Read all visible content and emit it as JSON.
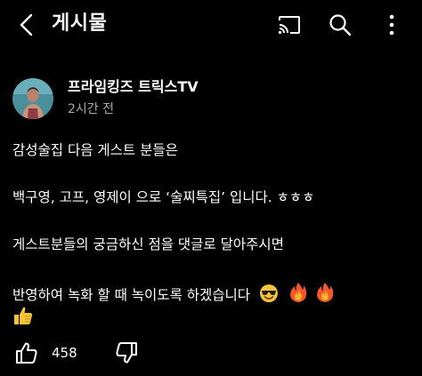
{
  "header": {
    "title": "게시물",
    "icons": [
      "back-arrow-icon",
      "cast-icon",
      "search-icon",
      "more-vertical-icon"
    ]
  },
  "post": {
    "channel_name": "프라임킹즈 트릭스TV",
    "time_ago": "2시간 전",
    "lines": [
      "감성술집 다음 게스트 분들은",
      "백구영, 고프, 영제이 으로 ‘술찌특집’ 입니다. ㅎㅎㅎ",
      "게스트분들의 궁금하신 점을 댓글로 달아주시면",
      "반영하여 녹화 할 때 녹이도록 하겠습니다"
    ],
    "emojis": [
      "sunglasses-emoji",
      "fire-emoji",
      "fire-emoji",
      "thumbs-up-emoji"
    ]
  },
  "actions": {
    "like_count": "458"
  }
}
